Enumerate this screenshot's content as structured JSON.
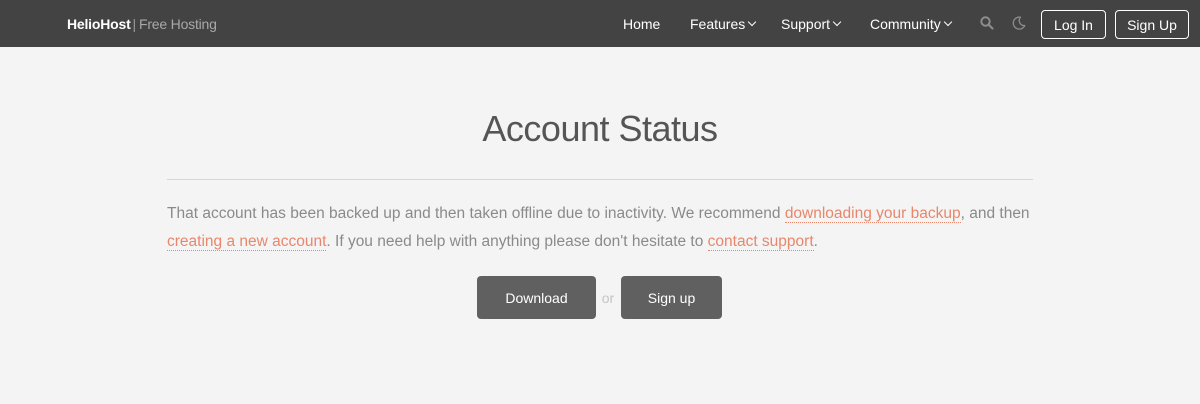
{
  "navbar": {
    "brand_name": "HelioHost",
    "brand_separator": "|",
    "brand_tagline": "Free Hosting",
    "links": {
      "home": "Home",
      "features": "Features",
      "support": "Support",
      "community": "Community"
    },
    "icons": {
      "search": "search-icon",
      "theme": "moon-icon"
    },
    "login_label": "Log In",
    "signup_label": "Sign Up"
  },
  "main": {
    "title": "Account Status",
    "message": {
      "part1": "That account has been backed up and then taken offline due to inactivity. We recommend ",
      "link_backup": "downloading your backup",
      "part2": ", and then ",
      "link_new_account": "creating a new account",
      "part3": ". If you need help with anything please don't hesitate to ",
      "link_support": "contact support",
      "part4": "."
    },
    "download_label": "Download",
    "or_label": "or",
    "signup_label": "Sign up"
  },
  "colors": {
    "navbar_bg": "#434343",
    "page_bg": "#f4f4f4",
    "link": "#e8876b",
    "button_bg": "#606060"
  }
}
